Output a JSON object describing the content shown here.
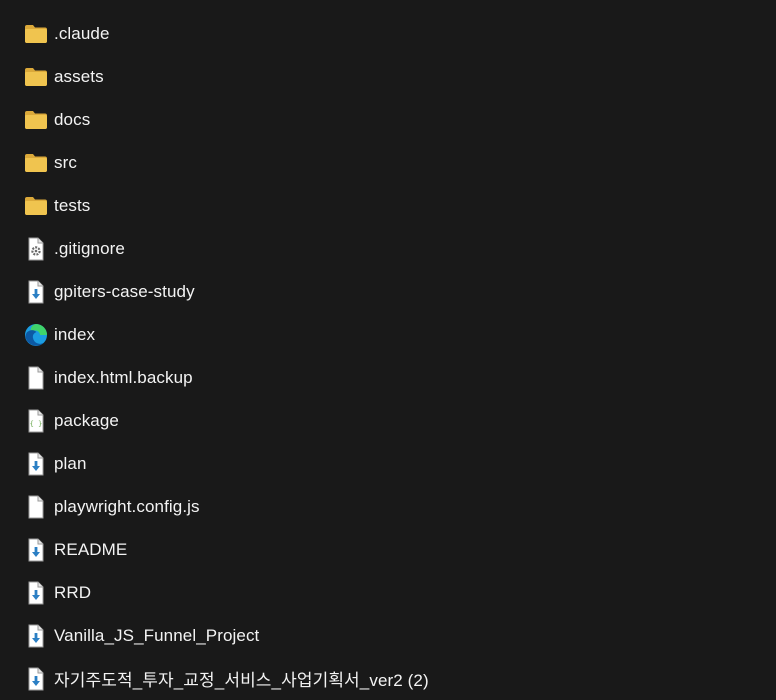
{
  "colors": {
    "background": "#191919",
    "folder": "#f0c44f",
    "folder_dark": "#dba93a",
    "text": "#f3f3f3",
    "download_arrow": "#2b7fc4",
    "file_bg": "#ffffff"
  },
  "items": [
    {
      "label": ".claude",
      "icon": "folder-icon"
    },
    {
      "label": "assets",
      "icon": "folder-icon"
    },
    {
      "label": "docs",
      "icon": "folder-icon"
    },
    {
      "label": "src",
      "icon": "folder-icon"
    },
    {
      "label": "tests",
      "icon": "folder-icon"
    },
    {
      "label": ".gitignore",
      "icon": "settings-file-icon"
    },
    {
      "label": "gpiters-case-study",
      "icon": "markdown-file-icon"
    },
    {
      "label": "index",
      "icon": "edge-browser-icon"
    },
    {
      "label": "index.html.backup",
      "icon": "blank-file-icon"
    },
    {
      "label": "package",
      "icon": "json-file-icon"
    },
    {
      "label": "plan",
      "icon": "markdown-file-icon"
    },
    {
      "label": "playwright.config.js",
      "icon": "blank-file-icon"
    },
    {
      "label": "README",
      "icon": "markdown-file-icon"
    },
    {
      "label": "RRD",
      "icon": "markdown-file-icon"
    },
    {
      "label": "Vanilla_JS_Funnel_Project",
      "icon": "markdown-file-icon"
    },
    {
      "label": "자기주도적_투자_교정_서비스_사업기획서_ver2 (2)",
      "icon": "markdown-file-icon"
    }
  ]
}
